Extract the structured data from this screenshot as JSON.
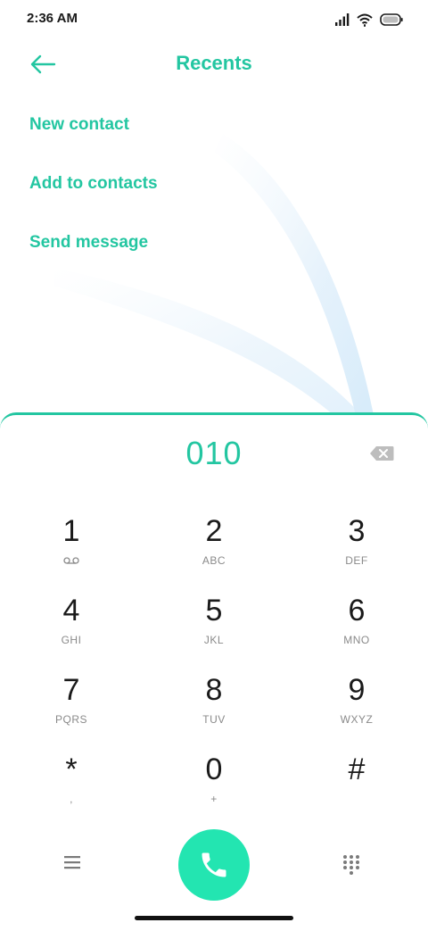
{
  "status_bar": {
    "time": "2:36 AM",
    "icons": [
      "signal-icon",
      "wifi-icon",
      "battery-icon"
    ]
  },
  "header": {
    "title": "Recents",
    "back_icon": "back-arrow-icon"
  },
  "actions": [
    {
      "label": "New contact"
    },
    {
      "label": "Add to contacts"
    },
    {
      "label": "Send message"
    }
  ],
  "dialer": {
    "number": "010",
    "backspace_icon": "backspace-icon",
    "keys": [
      {
        "digit": "1",
        "letters": ""
      },
      {
        "digit": "2",
        "letters": "ABC"
      },
      {
        "digit": "3",
        "letters": "DEF"
      },
      {
        "digit": "4",
        "letters": "GHI"
      },
      {
        "digit": "5",
        "letters": "JKL"
      },
      {
        "digit": "6",
        "letters": "MNO"
      },
      {
        "digit": "7",
        "letters": "PQRS"
      },
      {
        "digit": "8",
        "letters": "TUV"
      },
      {
        "digit": "9",
        "letters": "WXYZ"
      },
      {
        "digit": "*",
        "letters": ","
      },
      {
        "digit": "0",
        "letters": "+"
      },
      {
        "digit": "#",
        "letters": ""
      }
    ],
    "key1_sub_icon": "voicemail-icon"
  },
  "bottom_bar": {
    "menu_icon": "menu-icon",
    "call_icon": "phone-icon",
    "keypad_icon": "dialpad-icon"
  },
  "colors": {
    "accent": "#23c6a1",
    "call_button": "#23e5b1",
    "text_primary": "#1a1a1a",
    "text_secondary": "#8a8a8a"
  }
}
